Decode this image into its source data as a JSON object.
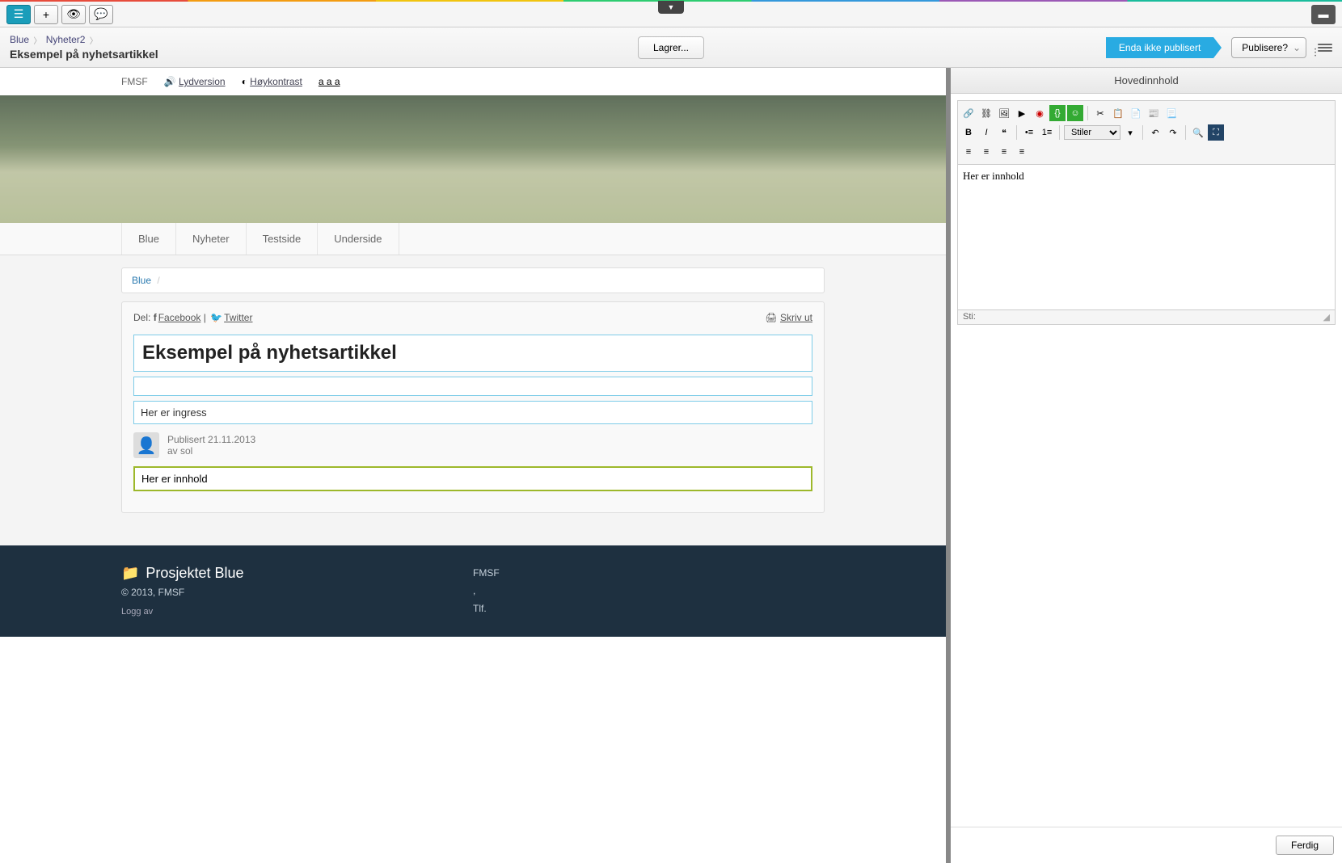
{
  "breadcrumb": {
    "root": "Blue",
    "section": "Nyheter2"
  },
  "page_title": "Eksempel på nyhetsartikkel",
  "status": {
    "saving": "Lagrer...",
    "publish_state": "Enda ikke publisert",
    "publish_action": "Publisere?"
  },
  "site_topbar": {
    "fmsf": "FMSF",
    "audio": "Lydversion",
    "contrast": "Høykontrast",
    "textsize": "a a a"
  },
  "nav": [
    "Blue",
    "Nyheter",
    "Testside",
    "Underside"
  ],
  "inner_breadcrumb": {
    "root": "Blue"
  },
  "share": {
    "label": "Del:",
    "facebook": "Facebook",
    "twitter": "Twitter",
    "print": "Skriv ut"
  },
  "article": {
    "title": "Eksempel på nyhetsartikkel",
    "subtitle": "",
    "ingress": "Her er ingress",
    "published_label": "Publisert 21.11.2013",
    "author": "av sol",
    "body": "Her er innhold"
  },
  "footer": {
    "project": "Prosjektet Blue",
    "copyright": "© 2013, FMSF",
    "logoff": "Logg av",
    "fmsf": "FMSF",
    "comma": ",",
    "tlf": "Tlf."
  },
  "editor": {
    "header": "Hovedinnhold",
    "styles_label": "Stiler",
    "content": "Her er innhold",
    "path_label": "Sti:",
    "done": "Ferdig"
  }
}
